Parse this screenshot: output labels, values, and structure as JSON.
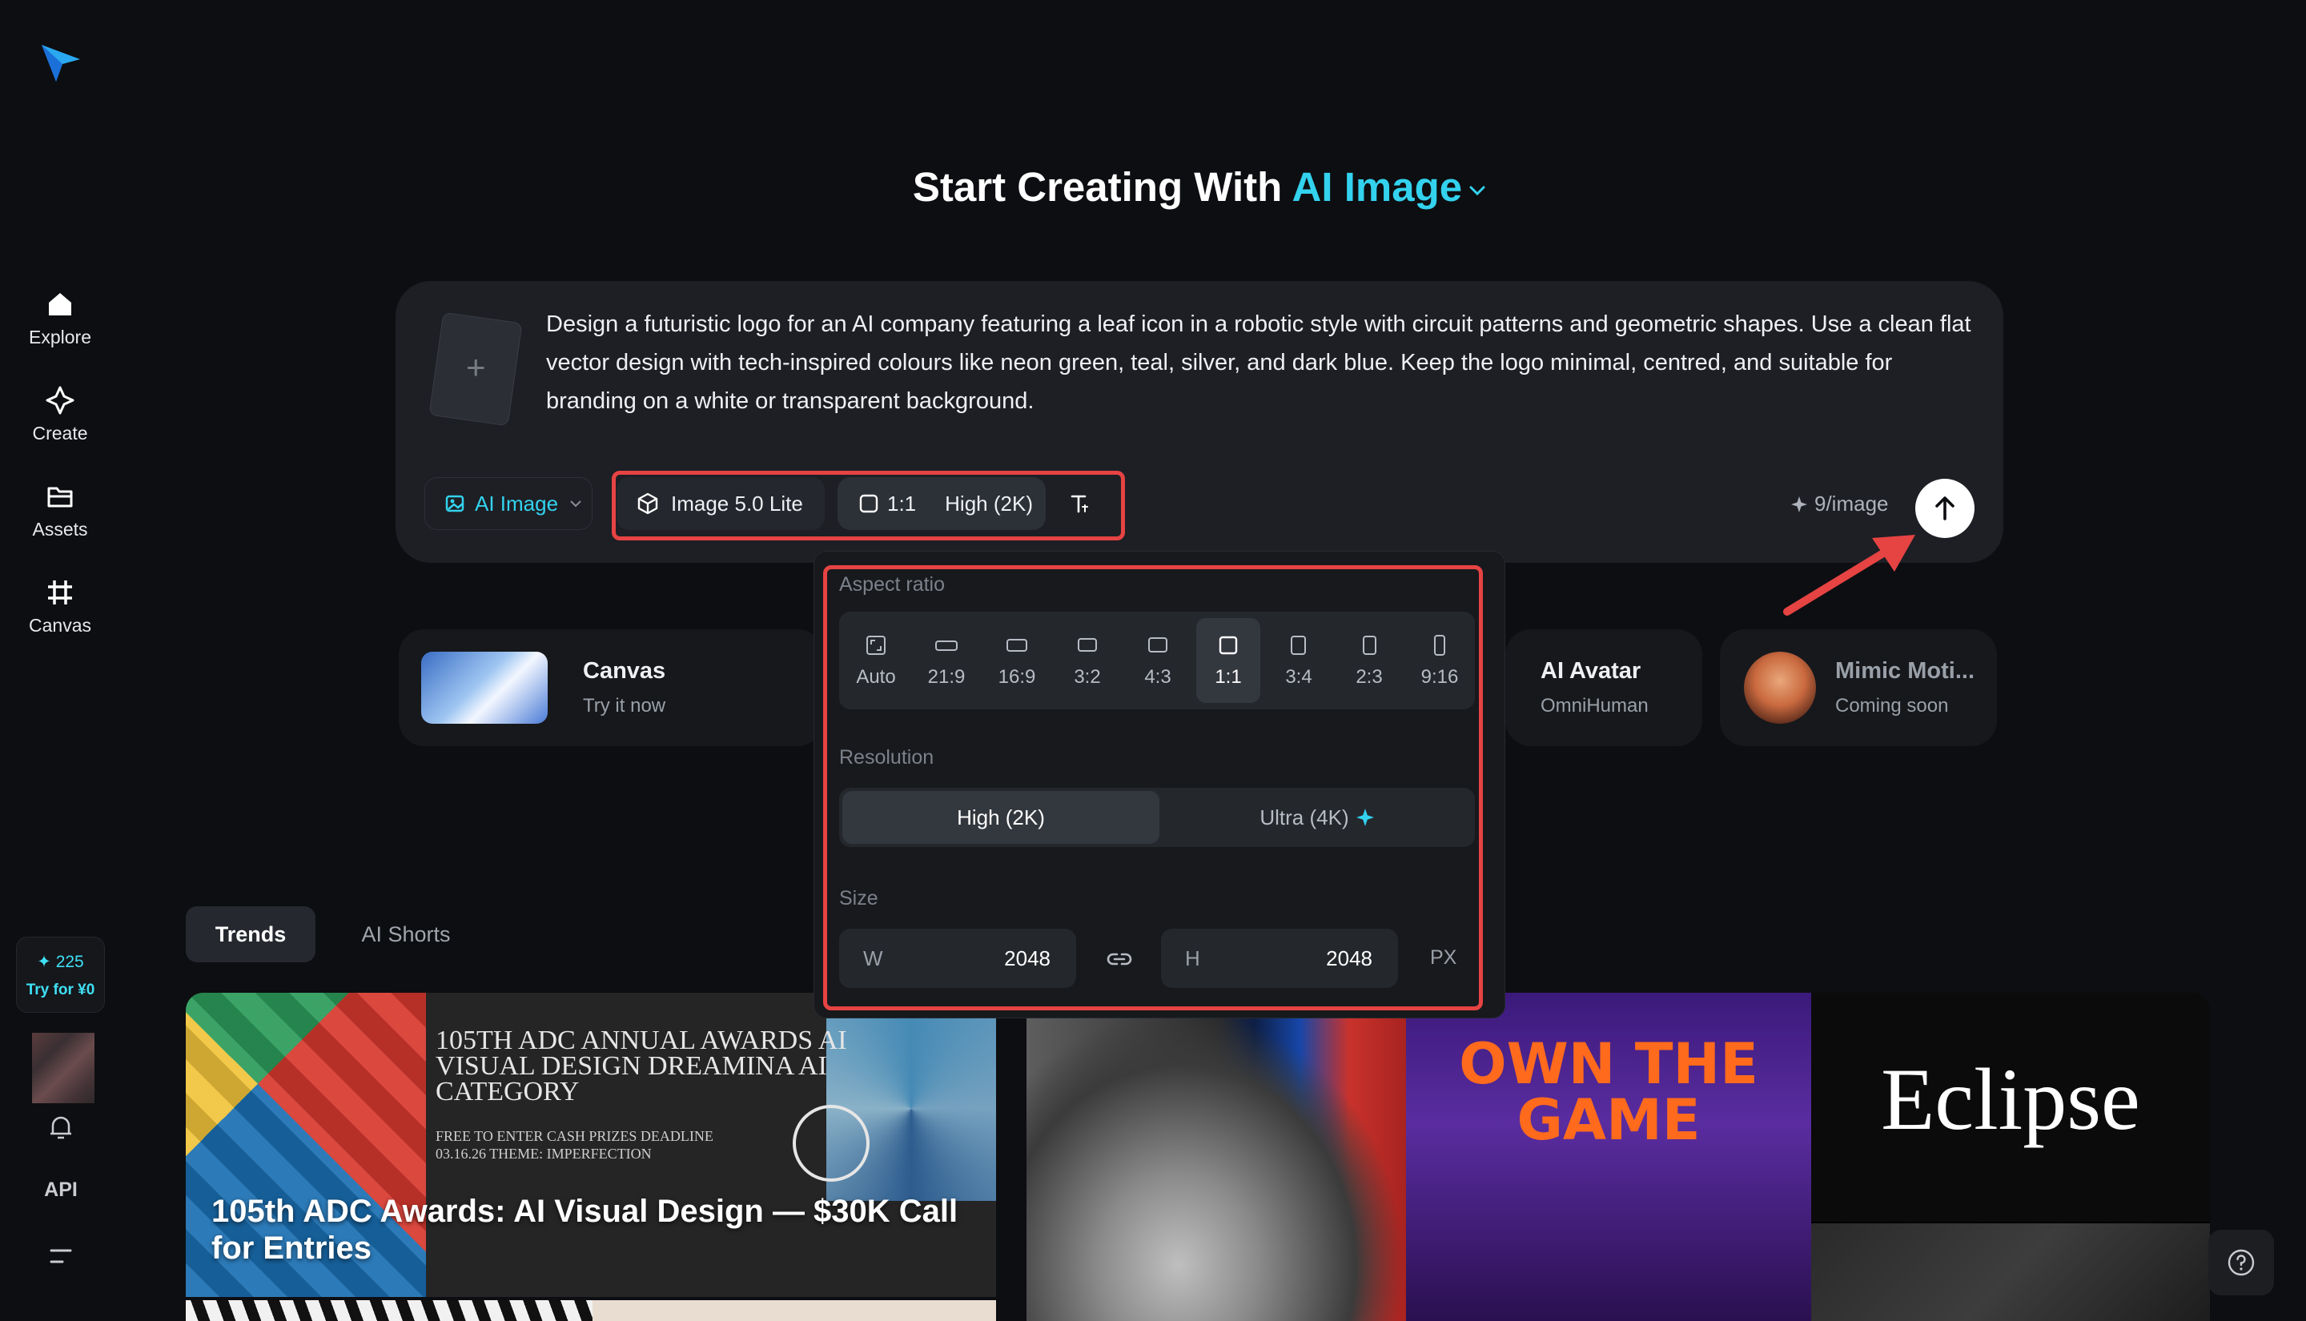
{
  "sidebar": {
    "items": [
      {
        "label": "Explore"
      },
      {
        "label": "Create"
      },
      {
        "label": "Assets"
      },
      {
        "label": "Canvas"
      }
    ],
    "credits": {
      "amount": "225",
      "cta": "Try for ¥0"
    },
    "api_label": "API"
  },
  "header": {
    "title_prefix": "Start Creating With",
    "title_accent": "AI Image"
  },
  "composer": {
    "prompt": "Design a futuristic logo for an AI company featuring a leaf icon in a robotic style with circuit patterns and geometric shapes. Use a clean flat vector design with tech-inspired colours like neon green, teal, silver, and dark blue. Keep the logo minimal, centred, and suitable for branding on a white or transparent background.",
    "add_reference": "+",
    "mode_label": "AI Image",
    "model_label": "Image 5.0 Lite",
    "ratio_label": "1:1",
    "quality_label": "High (2K)",
    "cost_label": "9/image"
  },
  "feature_cards": [
    {
      "title": "Canvas",
      "subtitle": "Try it now"
    },
    {
      "title": "AI Avatar",
      "subtitle": "OmniHuman"
    },
    {
      "title": "Mimic Moti...",
      "subtitle": "Coming soon"
    }
  ],
  "tabs": [
    {
      "label": "Trends",
      "active": true
    },
    {
      "label": "AI Shorts",
      "active": false
    }
  ],
  "gallery": [
    {
      "headline": "105TH ADC ANNUAL AWARDS AI VISUAL DESIGN DREAMINA AI CATEGORY",
      "details": "FREE TO ENTER CASH PRIZES DEADLINE 03.16.26 THEME: IMPERFECTION",
      "caption": "105th ADC Awards: AI Visual Design — $30K Call for Entries"
    },
    {
      "text": ""
    },
    {
      "text": "OWN THE GAME"
    },
    {
      "text": "Eclipse"
    }
  ],
  "popover": {
    "aspect_label": "Aspect ratio",
    "ratios": [
      "Auto",
      "21:9",
      "16:9",
      "3:2",
      "4:3",
      "1:1",
      "3:4",
      "2:3",
      "9:16"
    ],
    "selected_ratio": "1:1",
    "resolution_label": "Resolution",
    "resolutions": [
      "High (2K)",
      "Ultra (4K)"
    ],
    "selected_resolution": "High (2K)",
    "size_label": "Size",
    "width_key": "W",
    "width": "2048",
    "height_key": "H",
    "height": "2048",
    "unit": "PX"
  },
  "colors": {
    "accent": "#33d2ee",
    "annotation": "#e64343",
    "background": "#0d0e11"
  }
}
